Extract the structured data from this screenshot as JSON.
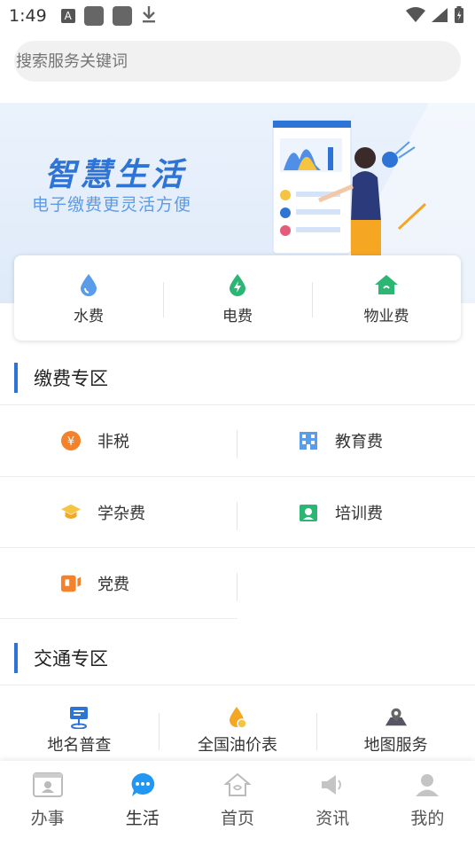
{
  "status_bar": {
    "time": "1:49",
    "a_icon": "A"
  },
  "search": {
    "placeholder": "搜索服务关键词"
  },
  "banner": {
    "title": "智慧生活",
    "subtitle": "电子缴费更灵活方便"
  },
  "utilities": [
    {
      "label": "水费",
      "icon": "water-drop-icon"
    },
    {
      "label": "电费",
      "icon": "electricity-icon"
    },
    {
      "label": "物业费",
      "icon": "house-icon"
    }
  ],
  "payment_section": {
    "title": "缴费专区",
    "items": [
      {
        "label": "非税",
        "icon": "yen-icon"
      },
      {
        "label": "教育费",
        "icon": "building-icon"
      },
      {
        "label": "学杂费",
        "icon": "graduation-cap-icon"
      },
      {
        "label": "培训费",
        "icon": "training-icon"
      },
      {
        "label": "党费",
        "icon": "party-flag-icon"
      }
    ]
  },
  "traffic_section": {
    "title": "交通专区",
    "items": [
      {
        "label": "地名普查",
        "icon": "place-survey-icon"
      },
      {
        "label": "全国油价表",
        "icon": "oil-drop-icon"
      },
      {
        "label": "地图服务",
        "icon": "map-pin-icon"
      }
    ]
  },
  "bottom_nav": [
    {
      "label": "办事",
      "icon": "id-card-icon"
    },
    {
      "label": "生活",
      "icon": "chat-bubble-icon",
      "active": true
    },
    {
      "label": "首页",
      "icon": "home-icon"
    },
    {
      "label": "资讯",
      "icon": "megaphone-icon"
    },
    {
      "label": "我的",
      "icon": "user-icon"
    }
  ],
  "colors": {
    "accent": "#2e74d6",
    "active_nav": "#2196f3",
    "orange": "#f5822a",
    "green": "#2bb673"
  }
}
